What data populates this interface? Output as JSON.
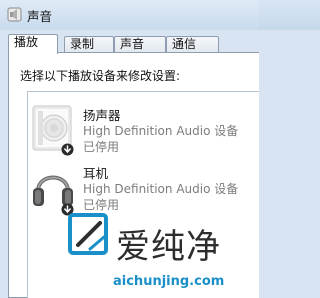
{
  "window": {
    "title": "声音",
    "icon": "speaker-icon"
  },
  "tabs": [
    {
      "label": "播放",
      "active": true
    },
    {
      "label": "录制",
      "active": false
    },
    {
      "label": "声音",
      "active": false
    },
    {
      "label": "通信",
      "active": false
    }
  ],
  "panel": {
    "instruction": "选择以下播放设备来修改设置:"
  },
  "devices": [
    {
      "name": "扬声器",
      "description": "High Definition Audio 设备",
      "status": "已停用",
      "icon": "speaker-device-icon",
      "badge_icon": "disabled-arrow-icon"
    },
    {
      "name": "耳机",
      "description": "High Definition Audio 设备",
      "status": "已停用",
      "icon": "headphones-icon",
      "badge_icon": "disabled-arrow-icon"
    }
  ],
  "watermark": {
    "text": "爱纯净",
    "url": "aichunjing.com",
    "logo": "watermark-logo",
    "colors": {
      "accent": "#1a8fc8",
      "text": "#2d2d2d"
    }
  }
}
